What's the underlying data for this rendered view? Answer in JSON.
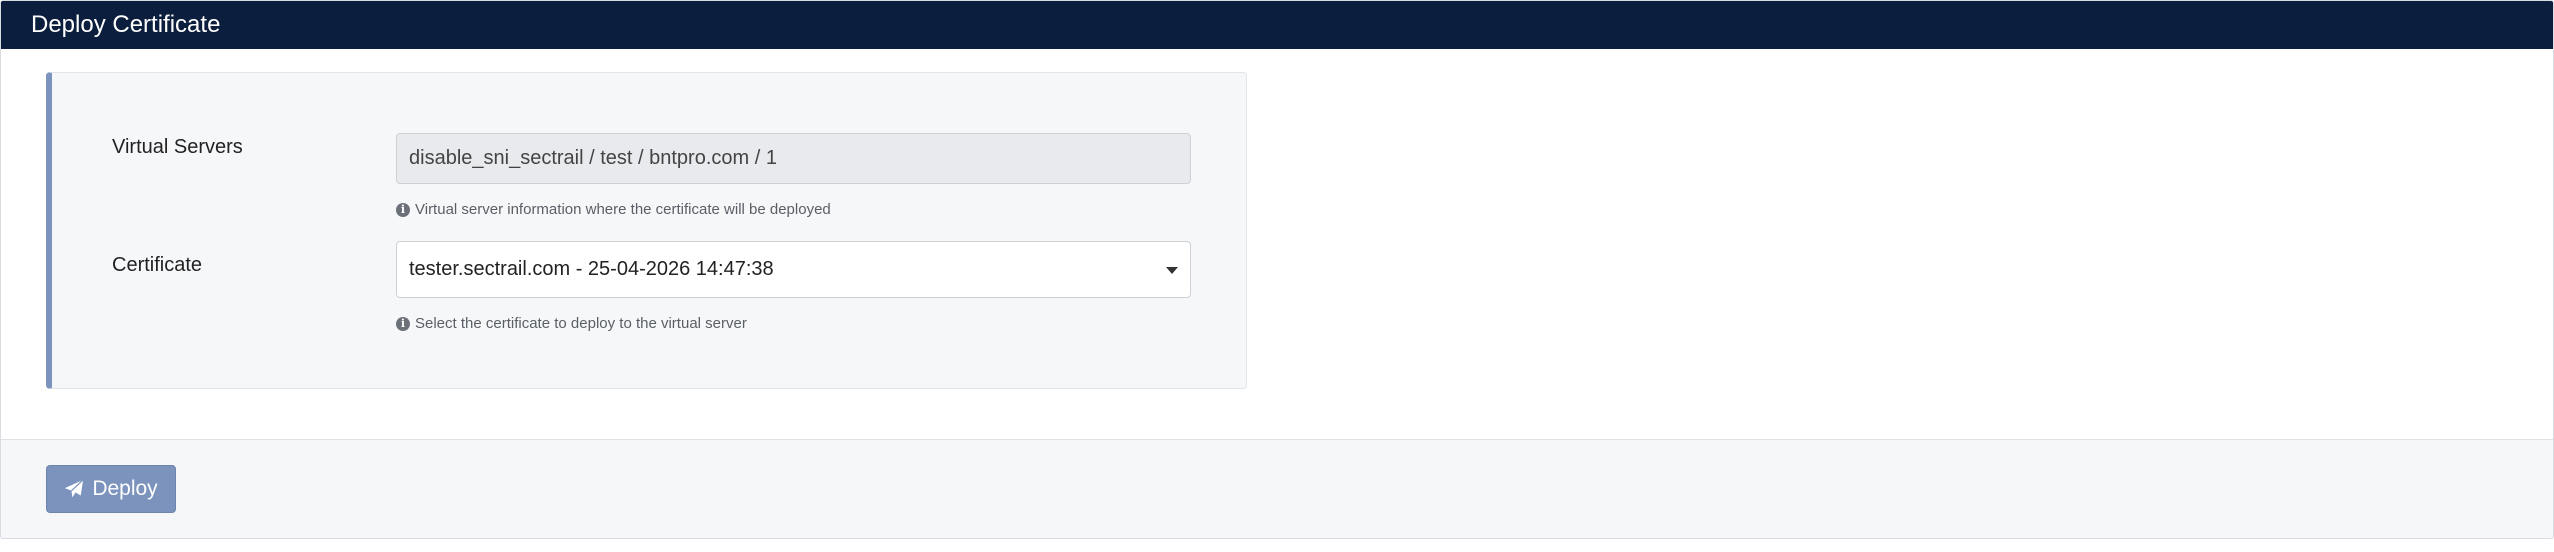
{
  "header": {
    "title": "Deploy Certificate"
  },
  "form": {
    "virtual_servers": {
      "label": "Virtual Servers",
      "value": "disable_sni_sectrail / test / bntpro.com / 1",
      "help": "Virtual server information where the certificate will be deployed"
    },
    "certificate": {
      "label": "Certificate",
      "selected": "tester.sectrail.com - 25-04-2026 14:47:38",
      "help": "Select the certificate to deploy to the virtual server"
    }
  },
  "footer": {
    "deploy_label": "Deploy"
  },
  "icons": {
    "info": "info-circle-icon",
    "deploy": "paper-plane-icon",
    "select_caret": "caret-down-icon"
  },
  "colors": {
    "header_bg": "#0b1e3d",
    "accent": "#7b93bd"
  }
}
